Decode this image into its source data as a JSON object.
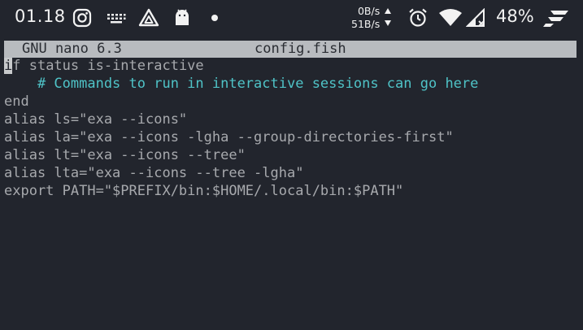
{
  "status_bar": {
    "time": "01.18",
    "net_up": "0B/s",
    "net_down": "51B/s",
    "battery": "48%",
    "icons": [
      "instagram-icon",
      "keyboard-icon",
      "app-triangle-icon",
      "android-icon",
      "notification-dot-icon",
      "alarm-icon",
      "wifi-icon",
      "cellular-signal-icon",
      "brand-logo-icon"
    ]
  },
  "nano": {
    "app": "GNU nano 6.3",
    "file": "config.fish",
    "cursor_char": "i",
    "first_line_rest": "f status is-interactive",
    "lines": [
      {
        "text": "    # Commands to run in interactive sessions can go here",
        "type": "comment"
      },
      {
        "text": "end",
        "type": "code"
      },
      {
        "text": "alias ls=\"exa --icons\"",
        "type": "code"
      },
      {
        "text": "alias la=\"exa --icons -lgha --group-directories-first\"",
        "type": "code"
      },
      {
        "text": "alias lt=\"exa --icons --tree\"",
        "type": "code"
      },
      {
        "text": "alias lta=\"exa --icons --tree -lgha\"",
        "type": "code"
      },
      {
        "text": "export PATH=\"$PREFIX/bin:$HOME/.local/bin:$PATH\"",
        "type": "code"
      }
    ]
  },
  "colors": {
    "background": "#22252d",
    "text": "#a7a9ad",
    "comment": "#4fc3c7",
    "titlebar": "#b8bbbf"
  }
}
